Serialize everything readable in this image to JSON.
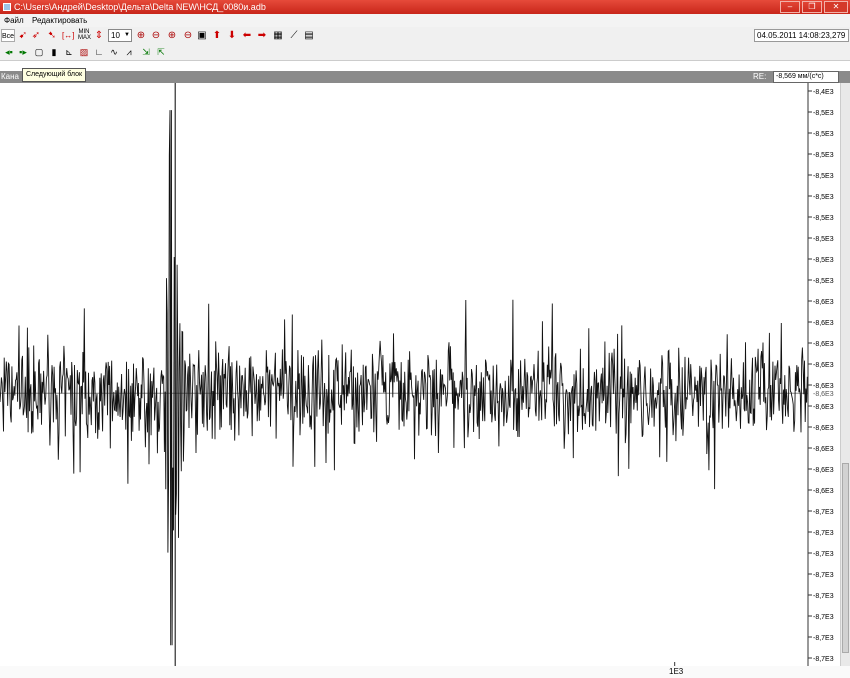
{
  "window": {
    "title": "C:\\Users\\Андрей\\Desktop\\Дельта\\Delta NEW\\НСД_0080и.adb",
    "minimize_label": "–",
    "restore_label": "❐",
    "close_label": "✕"
  },
  "menu": {
    "items": [
      {
        "label": "Файл"
      },
      {
        "label": "Редактировать"
      }
    ]
  },
  "toolbar": {
    "all_label": "Все",
    "scale_value": "10",
    "datetime": "04.05.2011 14:08:23,279",
    "icons": [
      "cursor-icon",
      "cursor-add-icon",
      "cursor-remove-icon",
      "fit-width-icon",
      "min-max-icon",
      "vertical-fit-icon",
      "zoom-in-icon",
      "zoom-out-icon",
      "zoom-x-in-icon",
      "zoom-x-out-icon",
      "monitor-icon",
      "arrow-up-icon",
      "arrow-down-icon",
      "arrow-left-icon",
      "arrow-right-icon",
      "grid-icon",
      "chart-icon",
      "table-icon"
    ]
  },
  "toolbar2": {
    "icons": [
      "prev-block-icon",
      "next-block-icon",
      "page-icon",
      "marker-icon",
      "trend-icon",
      "print-icon",
      "axis-icon",
      "axis-wave-icon",
      "axis-peak-icon",
      "export-icon",
      "import-icon"
    ]
  },
  "tooltip": {
    "text": "Следующий блок"
  },
  "channel_bar": {
    "label": "Кана",
    "re_label": "RE:",
    "re_value": "-8,569 мм/(c*c)"
  },
  "chart_data": {
    "type": "line",
    "title": "",
    "xlabel": "",
    "ylabel": "",
    "x_tick_labels": [
      "1E3"
    ],
    "y_tick_labels": [
      "-8,4E3",
      "-8,5E3",
      "-8,5E3",
      "-8,5E3",
      "-8,5E3",
      "-8,5E3",
      "-8,5E3",
      "-8,5E3",
      "-8,5E3",
      "-8,5E3",
      "-8,6E3",
      "-8,6E3",
      "-8,6E3",
      "-8,6E3",
      "-8,6E3",
      "-8,6E3",
      "-8,6E3",
      "-8,6E3",
      "-8,6E3",
      "-8,6E3",
      "-8,7E3",
      "-8,7E3",
      "-8,7E3",
      "-8,7E3",
      "-8,7E3",
      "-8,7E3",
      "-8,7E3",
      "-8,7E3"
    ],
    "current_value_label": "-8,6E3",
    "ylim": [
      -8700,
      -8420
    ],
    "xlim": [
      0,
      1190
    ],
    "baseline": -8569,
    "cursor_x": 258,
    "event": {
      "x": 252,
      "peak_max": -8433,
      "peak_min": -8690
    },
    "noise_amplitude": 25,
    "grid": false,
    "legend": "none"
  }
}
